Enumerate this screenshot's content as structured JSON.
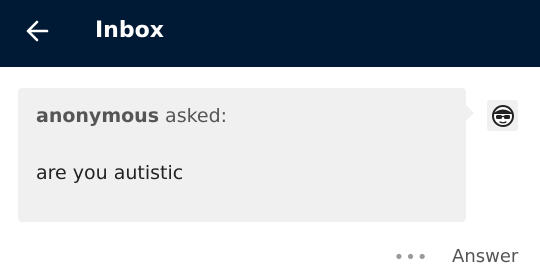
{
  "header": {
    "back_icon": "arrow-left-icon",
    "title": "Inbox",
    "background": "#001935"
  },
  "ask": {
    "asker": "anonymous",
    "asked_label": "asked:",
    "question": "are you autistic",
    "card_color": "#f0f0f0"
  },
  "avatar": {
    "icon": "avatar-face-sunglasses-icon"
  },
  "actions": {
    "more_icon": "more-dots-icon",
    "more_label": "•••",
    "answer_label": "Answer"
  }
}
